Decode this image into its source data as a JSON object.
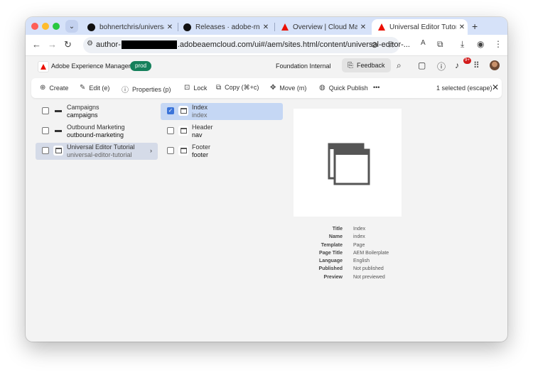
{
  "browser": {
    "tabs": [
      {
        "label": "bohnertchris/universal-ed",
        "icon": "github-icon"
      },
      {
        "label": "Releases · adobe-rndlaem",
        "icon": "github-icon"
      },
      {
        "label": "Overview | Cloud Manage",
        "icon": "adobe-icon"
      },
      {
        "label": "Universal Editor Tutorial",
        "icon": "adobe-icon",
        "active": true
      }
    ],
    "new_tab": "+",
    "url_prefix": "author-",
    "url_suffix": ".adobeaemcloud.com/ui#/aem/sites.html/content/universal-editor-..."
  },
  "aem": {
    "app_name": "Adobe Experience Manager",
    "env_badge": "prod",
    "org_name": "Foundation Internal",
    "feedback_label": "Feedback",
    "notification_count": "9+"
  },
  "actions": {
    "items": [
      {
        "label": "Create",
        "icon": "plus-circle-icon"
      },
      {
        "label": "Edit (e)",
        "icon": "pencil-icon"
      },
      {
        "label": "Properties (p)",
        "icon": "info-icon"
      },
      {
        "label": "Lock",
        "icon": "lock-icon"
      },
      {
        "label": "Copy (⌘+c)",
        "icon": "copy-icon"
      },
      {
        "label": "Move (m)",
        "icon": "move-icon"
      },
      {
        "label": "Quick Publish",
        "icon": "globe-icon"
      }
    ],
    "more": "•••",
    "selection": "1 selected (escape)"
  },
  "columns": {
    "left": [
      {
        "title": "Campaigns",
        "name": "campaigns",
        "type": "folder"
      },
      {
        "title": "Outbound Marketing",
        "name": "outbound-marketing",
        "type": "folder"
      },
      {
        "title": "Universal Editor Tutorial",
        "name": "universal-editor-tutorial",
        "type": "page",
        "selected": true
      }
    ],
    "middle": [
      {
        "title": "Index",
        "name": "index",
        "checked": true
      },
      {
        "title": "Header",
        "name": "nav"
      },
      {
        "title": "Footer",
        "name": "footer"
      }
    ]
  },
  "details": [
    {
      "key": "Title",
      "value": "Index"
    },
    {
      "key": "Name",
      "value": "index"
    },
    {
      "key": "Template",
      "value": "Page"
    },
    {
      "key": "Page Title",
      "value": "AEM Boilerplate"
    },
    {
      "key": "Language",
      "value": "English"
    },
    {
      "key": "Published",
      "value": "Not published"
    },
    {
      "key": "Preview",
      "value": "Not previewed"
    }
  ],
  "colors": {
    "accent": "#3b74d9",
    "badge": "#15805b",
    "adobe_red": "#eb1000"
  }
}
